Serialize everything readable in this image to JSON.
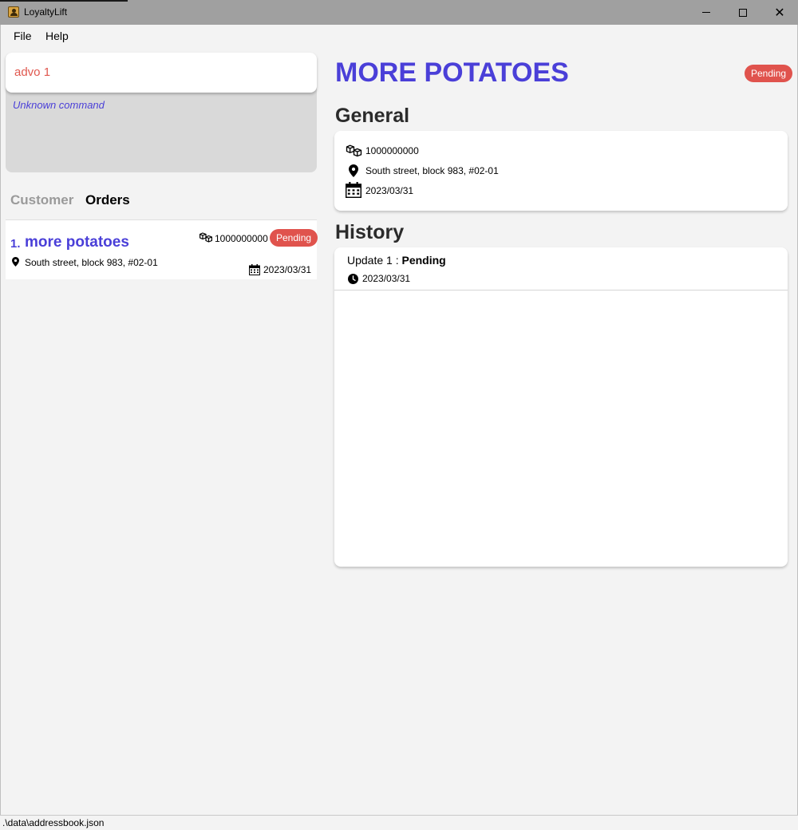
{
  "window": {
    "title": "LoyaltyLift"
  },
  "menu": {
    "file": "File",
    "help": "Help"
  },
  "command": {
    "value": "advo 1"
  },
  "result": {
    "message": "Unknown command"
  },
  "tabs": {
    "customer": "Customer",
    "orders": "Orders"
  },
  "order_list": [
    {
      "index": "1.",
      "name": "more potatoes",
      "quantity": "1000000000",
      "status": "Pending",
      "address": "South street, block 983, #02-01",
      "date": "2023/03/31"
    }
  ],
  "detail": {
    "title": "MORE POTATOES",
    "status": "Pending",
    "general_heading": "General",
    "quantity": "1000000000",
    "address": "South street, block 983, #02-01",
    "date": "2023/03/31",
    "history_heading": "History",
    "history": [
      {
        "label": "Update 1 : ",
        "status": "Pending",
        "date": "2023/03/31"
      }
    ]
  },
  "statusbar": {
    "path": ".\\data\\addressbook.json"
  },
  "colors": {
    "accent": "#4a3fd8",
    "badge": "#e0534d",
    "command_error": "#e0584f"
  },
  "icons": [
    "cubes-icon",
    "map-marker-icon",
    "calendar-icon",
    "clock-icon"
  ]
}
